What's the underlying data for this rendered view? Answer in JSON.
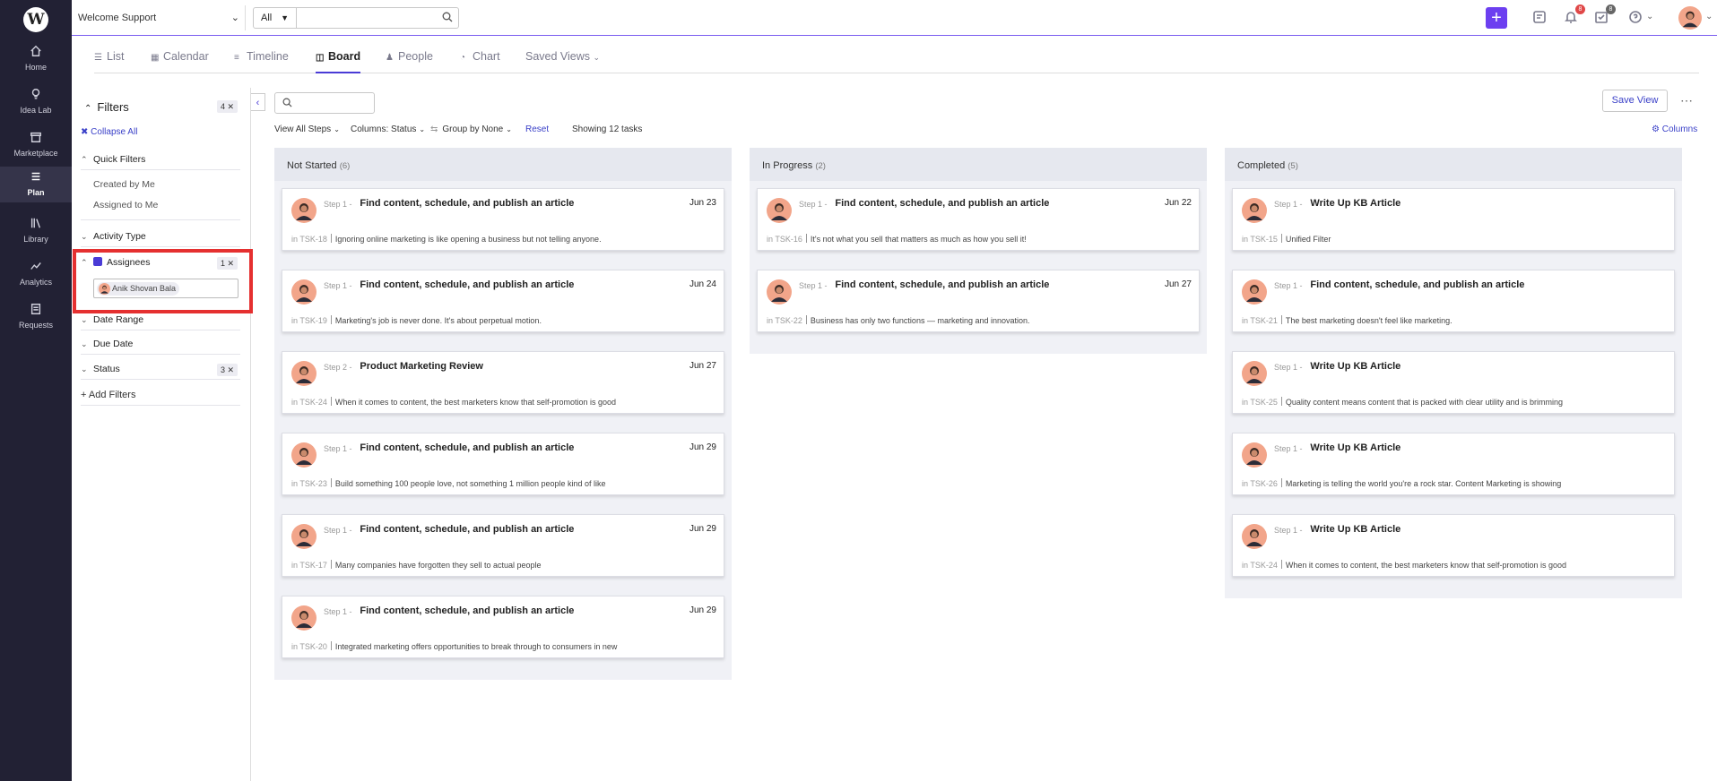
{
  "nav": {
    "logo": "W",
    "items": [
      {
        "label": "Home"
      },
      {
        "label": "Idea Lab"
      },
      {
        "label": "Marketplace"
      },
      {
        "label": "Plan"
      },
      {
        "label": "Library"
      },
      {
        "label": "Analytics"
      },
      {
        "label": "Requests"
      }
    ]
  },
  "topbar": {
    "workspace": "Welcome Support",
    "search_scope": "All",
    "search_placeholder": "",
    "notifications_count": "8",
    "tasks_count": "8",
    "accent": "#6c3ff0"
  },
  "tabs": [
    {
      "label": "List"
    },
    {
      "label": "Calendar"
    },
    {
      "label": "Timeline"
    },
    {
      "label": "Board"
    },
    {
      "label": "People"
    },
    {
      "label": "Chart"
    },
    {
      "label": "Saved Views"
    }
  ],
  "filters": {
    "title": "Filters",
    "count": "4 ✕",
    "collapse_all": "Collapse All",
    "quick_filters": "Quick Filters",
    "created_by_me": "Created by Me",
    "assigned_to_me": "Assigned to Me",
    "activity_type": "Activity Type",
    "assignees": "Assignees",
    "assignees_count": "1 ✕",
    "assignee_name": "Anik Shovan Bala",
    "date_range": "Date Range",
    "due_date": "Due Date",
    "status": "Status",
    "status_count": "3 ✕",
    "add_filters": "+ Add Filters"
  },
  "toolbar": {
    "view_steps": "View All Steps",
    "columns_label": "Columns:",
    "columns_value": "Status",
    "group_by_label": "Group by",
    "group_by_value": "None",
    "reset": "Reset",
    "showing": "Showing 12 tasks",
    "save_view": "Save View",
    "columns_link": "Columns"
  },
  "columns": [
    {
      "title": "Not Started",
      "count": "(6)",
      "cards": [
        {
          "step": "Step 1 -",
          "title": "Find content, schedule, and publish an article",
          "date": "Jun 23",
          "in": "in",
          "task": "TSK-18",
          "desc": "Ignoring online marketing is like opening a business but not telling anyone."
        },
        {
          "step": "Step 1 -",
          "title": "Find content, schedule, and publish an article",
          "date": "Jun 24",
          "in": "in",
          "task": "TSK-19",
          "desc": "Marketing's job is never done. It's about perpetual motion."
        },
        {
          "step": "Step 2 -",
          "title": "Product Marketing Review",
          "date": "Jun 27",
          "in": "in",
          "task": "TSK-24",
          "desc": "When it comes to content, the best marketers know that self-promotion is good"
        },
        {
          "step": "Step 1 -",
          "title": "Find content, schedule, and publish an article",
          "date": "Jun 29",
          "in": "in",
          "task": "TSK-23",
          "desc": "Build something 100 people love, not something 1 million people kind of like"
        },
        {
          "step": "Step 1 -",
          "title": "Find content, schedule, and publish an article",
          "date": "Jun 29",
          "in": "in",
          "task": "TSK-17",
          "desc": "Many companies have forgotten they sell to actual people"
        },
        {
          "step": "Step 1 -",
          "title": "Find content, schedule, and publish an article",
          "date": "Jun 29",
          "in": "in",
          "task": "TSK-20",
          "desc": "Integrated marketing offers opportunities to break through to consumers in new"
        }
      ]
    },
    {
      "title": "In Progress",
      "count": "(2)",
      "cards": [
        {
          "step": "Step 1 -",
          "title": "Find content, schedule, and publish an article",
          "date": "Jun 22",
          "in": "in",
          "task": "TSK-16",
          "desc": "It's not what you sell that matters as much as how you sell it!"
        },
        {
          "step": "Step 1 -",
          "title": "Find content, schedule, and publish an article",
          "date": "Jun 27",
          "in": "in",
          "task": "TSK-22",
          "desc": "Business has only two functions — marketing and innovation."
        }
      ]
    },
    {
      "title": "Completed",
      "count": "(5)",
      "cards": [
        {
          "step": "Step 1 -",
          "title": "Write Up KB Article",
          "date": "",
          "in": "in",
          "task": "TSK-15",
          "desc": "Unified Filter"
        },
        {
          "step": "Step 1 -",
          "title": "Find content, schedule, and publish an article",
          "date": "",
          "in": "in",
          "task": "TSK-21",
          "desc": "The best marketing doesn't feel like marketing."
        },
        {
          "step": "Step 1 -",
          "title": "Write Up KB Article",
          "date": "",
          "in": "in",
          "task": "TSK-25",
          "desc": "Quality content means content that is packed with clear utility and is brimming"
        },
        {
          "step": "Step 1 -",
          "title": "Write Up KB Article",
          "date": "",
          "in": "in",
          "task": "TSK-26",
          "desc": "Marketing is telling the world you're a rock star. Content Marketing is showing"
        },
        {
          "step": "Step 1 -",
          "title": "Write Up KB Article",
          "date": "",
          "in": "in",
          "task": "TSK-24",
          "desc": "When it comes to content, the best marketers know that self-promotion is good"
        }
      ]
    }
  ]
}
